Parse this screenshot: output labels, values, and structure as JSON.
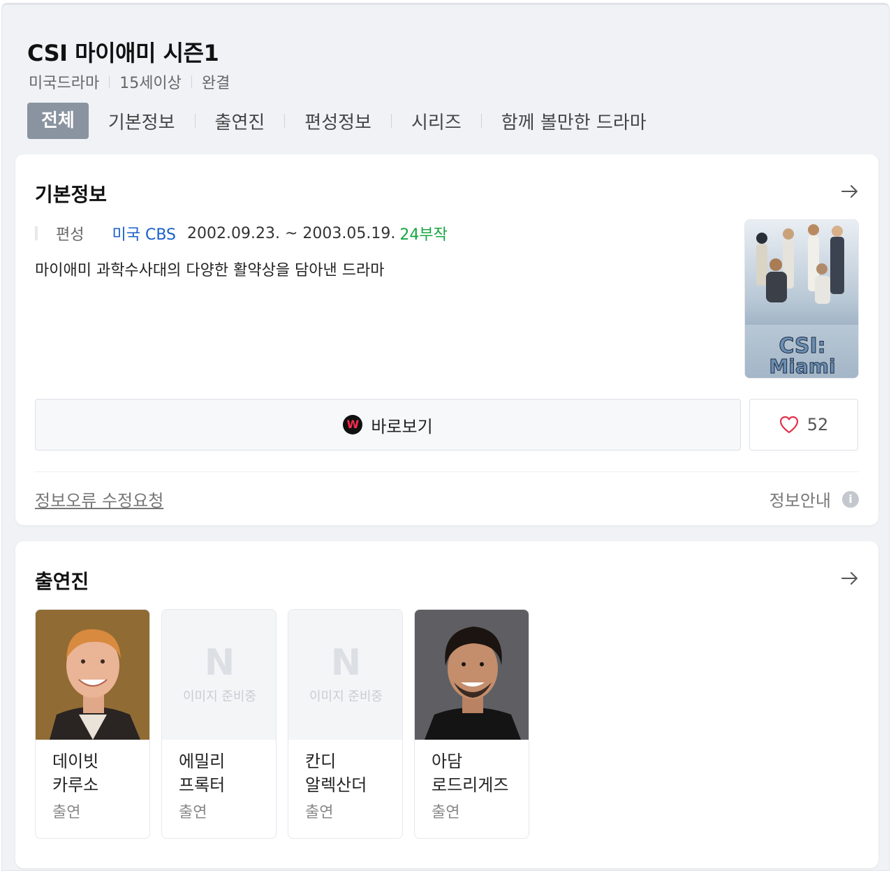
{
  "header": {
    "title": "CSI 마이애미 시즌1",
    "meta": [
      "미국드라마",
      "15세이상",
      "완결"
    ]
  },
  "tabs": [
    {
      "label": "전체",
      "active": true
    },
    {
      "label": "기본정보",
      "active": false
    },
    {
      "label": "출연진",
      "active": false
    },
    {
      "label": "편성정보",
      "active": false
    },
    {
      "label": "시리즈",
      "active": false
    },
    {
      "label": "함께 볼만한 드라마",
      "active": false
    }
  ],
  "basic_info": {
    "title": "기본정보",
    "label": "편성",
    "channel": "미국 CBS",
    "dates": "2002.09.23. ~ 2003.05.19.",
    "episodes": "24부작",
    "description": "마이애미 과학수사대의 다양한 활약상을 담아낸 드라마",
    "poster_text_1": "CSI:",
    "poster_text_2": "Miami",
    "watch_label": "바로보기",
    "watch_logo": "W",
    "like_count": "52",
    "report_link": "정보오류 수정요청",
    "guide_label": "정보안내",
    "guide_icon_text": "i"
  },
  "cast": {
    "title": "출연진",
    "placeholder_logo": "N",
    "placeholder_text": "이미지 준비중",
    "members": [
      {
        "name": "데이빗 카루소",
        "role": "출연",
        "has_photo": true
      },
      {
        "name": "에밀리 프록터",
        "role": "출연",
        "has_photo": false
      },
      {
        "name": "칸디 알렉산더",
        "role": "출연",
        "has_photo": false
      },
      {
        "name": "아담 로드리게즈",
        "role": "출연",
        "has_photo": true
      }
    ]
  },
  "colors": {
    "channel": "#1a5fc8",
    "episodes": "#17a640",
    "active_tab_bg": "#8a93a0",
    "heart": "#e5304a"
  }
}
